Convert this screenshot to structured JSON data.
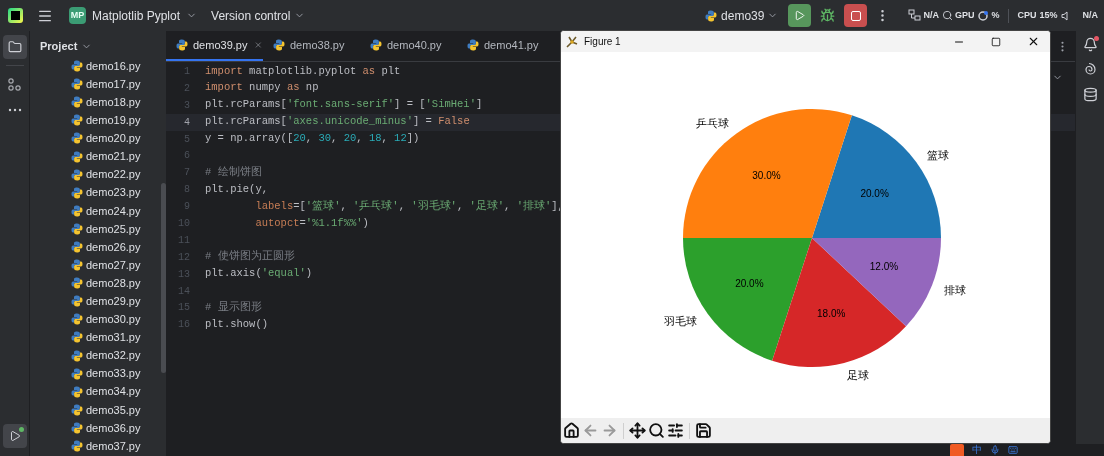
{
  "header": {
    "project_badge": "MP",
    "project_name": "Matplotlib Pyplot",
    "vcs": "Version control",
    "run_config": "demo39",
    "status": [
      {
        "kind": "network",
        "text": "N/A"
      },
      {
        "kind": "gpu",
        "text": "GPU"
      },
      {
        "kind": "gpu_pct",
        "text": "%"
      },
      {
        "kind": "cpu",
        "text": "CPU"
      },
      {
        "kind": "cpu_pct",
        "text": "15%"
      },
      {
        "kind": "other",
        "text": "N/A"
      }
    ]
  },
  "project_panel": {
    "title": "Project",
    "files": [
      "demo16.py",
      "demo17.py",
      "demo18.py",
      "demo19.py",
      "demo20.py",
      "demo21.py",
      "demo22.py",
      "demo23.py",
      "demo24.py",
      "demo25.py",
      "demo26.py",
      "demo27.py",
      "demo28.py",
      "demo29.py",
      "demo30.py",
      "demo31.py",
      "demo32.py",
      "demo33.py",
      "demo34.py",
      "demo35.py",
      "demo36.py",
      "demo37.py"
    ]
  },
  "tabs": [
    {
      "label": "demo39.py",
      "selected": true
    },
    {
      "label": "demo38.py",
      "selected": false
    },
    {
      "label": "demo40.py",
      "selected": false
    },
    {
      "label": "demo41.py",
      "selected": false
    }
  ],
  "code": [
    {
      "number": "1",
      "current": false,
      "tokens": [
        {
          "kind": "keyword",
          "text": "import"
        },
        {
          "kind": "plain",
          "text": " matplotlib.pyplot "
        },
        {
          "kind": "keyword",
          "text": "as"
        },
        {
          "kind": "plain",
          "text": " plt"
        }
      ]
    },
    {
      "number": "2",
      "current": false,
      "tokens": [
        {
          "kind": "keyword",
          "text": "import"
        },
        {
          "kind": "plain",
          "text": " numpy "
        },
        {
          "kind": "keyword",
          "text": "as"
        },
        {
          "kind": "plain",
          "text": " np"
        }
      ]
    },
    {
      "number": "3",
      "current": false,
      "tokens": [
        {
          "kind": "plain",
          "text": "plt.rcParams["
        },
        {
          "kind": "string",
          "text": "'font.sans-serif'"
        },
        {
          "kind": "plain",
          "text": "] = ["
        },
        {
          "kind": "string",
          "text": "'SimHei'"
        },
        {
          "kind": "plain",
          "text": "]"
        }
      ]
    },
    {
      "number": "4",
      "current": true,
      "tokens": [
        {
          "kind": "plain",
          "text": "plt.rcParams["
        },
        {
          "kind": "string",
          "text": "'axes.unicode_minus'"
        },
        {
          "kind": "plain",
          "text": "] = "
        },
        {
          "kind": "keyword",
          "text": "False"
        }
      ]
    },
    {
      "number": "5",
      "current": false,
      "tokens": [
        {
          "kind": "plain",
          "text": "y = np.array(["
        },
        {
          "kind": "number",
          "text": "20"
        },
        {
          "kind": "plain",
          "text": ", "
        },
        {
          "kind": "number",
          "text": "30"
        },
        {
          "kind": "plain",
          "text": ", "
        },
        {
          "kind": "number",
          "text": "20"
        },
        {
          "kind": "plain",
          "text": ", "
        },
        {
          "kind": "number",
          "text": "18"
        },
        {
          "kind": "plain",
          "text": ", "
        },
        {
          "kind": "number",
          "text": "12"
        },
        {
          "kind": "plain",
          "text": "])"
        }
      ]
    },
    {
      "number": "6",
      "current": false
    },
    {
      "number": "7",
      "current": false,
      "tokens": [
        {
          "kind": "comment",
          "text": "# 绘制饼图"
        }
      ]
    },
    {
      "number": "8",
      "current": false,
      "tokens": [
        {
          "kind": "plain",
          "text": "plt.pie(y,"
        }
      ]
    },
    {
      "number": "9",
      "current": false,
      "tokens": [
        {
          "kind": "param",
          "text": "        labels"
        },
        {
          "kind": "plain",
          "text": "=["
        },
        {
          "kind": "string",
          "text": "'篮球'"
        },
        {
          "kind": "plain",
          "text": ", "
        },
        {
          "kind": "string",
          "text": "'乒乓球'"
        },
        {
          "kind": "plain",
          "text": ", "
        },
        {
          "kind": "string",
          "text": "'羽毛球'"
        },
        {
          "kind": "plain",
          "text": ", "
        },
        {
          "kind": "string",
          "text": "'足球'"
        },
        {
          "kind": "plain",
          "text": ", "
        },
        {
          "kind": "string",
          "text": "'排球'"
        },
        {
          "kind": "plain",
          "text": "],"
        }
      ]
    },
    {
      "number": "10",
      "current": false,
      "tokens": [
        {
          "kind": "param",
          "text": "        autopct"
        },
        {
          "kind": "plain",
          "text": "="
        },
        {
          "kind": "string",
          "text": "'%1.1f%%'"
        },
        {
          "kind": "plain",
          "text": ")"
        }
      ]
    },
    {
      "number": "11",
      "current": false
    },
    {
      "number": "12",
      "current": false,
      "tokens": [
        {
          "kind": "comment",
          "text": "# 使饼图为正圆形"
        }
      ]
    },
    {
      "number": "13",
      "current": false,
      "tokens": [
        {
          "kind": "plain",
          "text": "plt.axis("
        },
        {
          "kind": "string",
          "text": "'equal'"
        },
        {
          "kind": "plain",
          "text": ")"
        }
      ]
    },
    {
      "number": "14",
      "current": false
    },
    {
      "number": "15",
      "current": false,
      "tokens": [
        {
          "kind": "comment",
          "text": "# 显示图形"
        }
      ]
    },
    {
      "number": "16",
      "current": false,
      "tokens": [
        {
          "kind": "plain",
          "text": "plt.show()"
        }
      ]
    }
  ],
  "figure_window": {
    "title": "Figure 1",
    "chart_data": {
      "type": "pie",
      "categories": [
        "篮球",
        "乒乓球",
        "羽毛球",
        "足球",
        "排球"
      ],
      "values": [
        20,
        30,
        20,
        18,
        12
      ],
      "colors": [
        "#1f77b4",
        "#ff7f0e",
        "#2ca02c",
        "#d62728",
        "#9467bd"
      ],
      "value_labels": [
        "20.0%",
        "30.0%",
        "20.0%",
        "18.0%",
        "12.0%"
      ]
    },
    "toolbar": [
      {
        "kind": "home",
        "disabled": false
      },
      {
        "kind": "back",
        "disabled": true
      },
      {
        "kind": "forward",
        "disabled": true
      },
      {
        "kind": "pan",
        "disabled": false
      },
      {
        "kind": "zoom",
        "disabled": false
      },
      {
        "kind": "configure",
        "disabled": false
      },
      {
        "kind": "save",
        "disabled": false
      }
    ]
  },
  "tray": {
    "ime_mode": "中"
  }
}
